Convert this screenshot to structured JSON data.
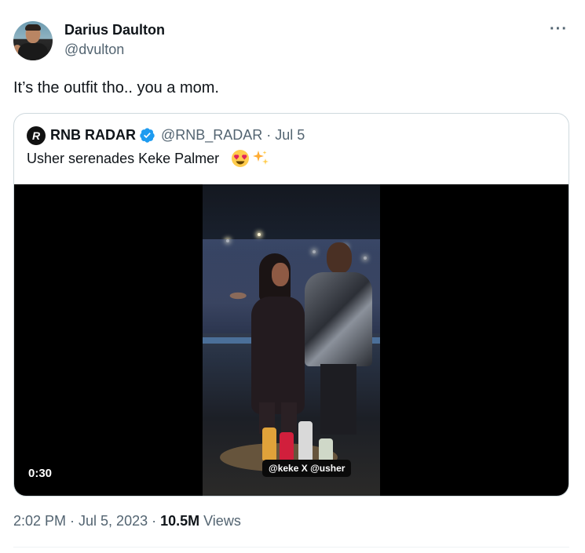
{
  "author": {
    "display_name": "Darius Daulton",
    "handle": "@dvulton"
  },
  "more_icon": "···",
  "tweet_text": "It’s the outfit tho.. you a mom.",
  "quoted": {
    "logo_letter": "R",
    "name": "RNB RADAR",
    "handle_date": "@RNB_RADAR · Jul 5",
    "text": "Usher serenades Keke Palmer",
    "emojis": [
      "heart-eyes",
      "sparkles"
    ],
    "verified_color": "#1d9bf0",
    "media": {
      "duration": "0:30",
      "overlay_text": "@keke X @usher"
    }
  },
  "meta": {
    "time_date": "2:02 PM · Jul 5, 2023 · ",
    "views_count": "10.5M",
    "views_label": " Views"
  }
}
